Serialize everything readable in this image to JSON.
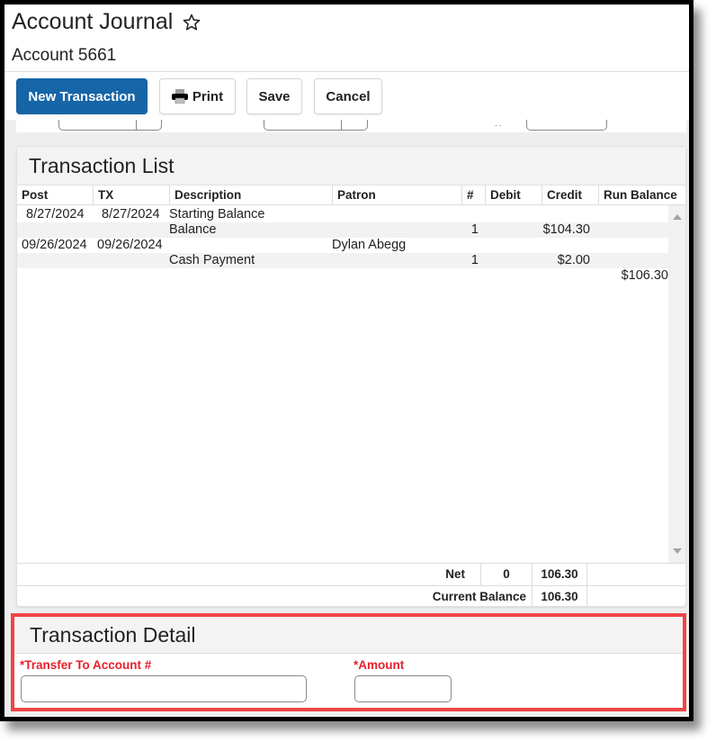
{
  "header": {
    "title": "Account Journal",
    "favorite_icon": "star-outline-icon",
    "subtitle": "Account 5661"
  },
  "toolbar": {
    "new_transaction_label": "New Transaction",
    "print_label": "Print",
    "print_icon": "printer-icon",
    "save_label": "Save",
    "cancel_label": "Cancel"
  },
  "transaction_list": {
    "title": "Transaction List",
    "columns": [
      "Post",
      "TX",
      "Description",
      "Patron",
      "#",
      "Debit",
      "Credit",
      "Run Balance"
    ],
    "rows": [
      {
        "post": "8/27/2024",
        "tx": "8/27/2024",
        "description": "Starting Balance",
        "patron": "",
        "count": "",
        "debit": "",
        "credit": "",
        "run_balance": ""
      },
      {
        "post": "",
        "tx": "",
        "description": "Balance",
        "patron": "",
        "count": "1",
        "debit": "",
        "credit": "$104.30",
        "run_balance": ""
      },
      {
        "post": "09/26/2024",
        "tx": "09/26/2024",
        "description": "",
        "patron": "Dylan Abegg",
        "count": "",
        "debit": "",
        "credit": "",
        "run_balance": ""
      },
      {
        "post": "",
        "tx": "",
        "description": "Cash Payment",
        "patron": "",
        "count": "1",
        "debit": "",
        "credit": "$2.00",
        "run_balance": ""
      },
      {
        "post": "",
        "tx": "",
        "description": "",
        "patron": "",
        "count": "",
        "debit": "",
        "credit": "",
        "run_balance": "$106.30"
      }
    ],
    "totals": {
      "net_label": "Net",
      "net_debit": "0",
      "net_credit": "106.30",
      "current_balance_label": "Current Balance",
      "current_balance_value": "106.30"
    }
  },
  "transaction_detail": {
    "title": "Transaction Detail",
    "transfer_label": "*Transfer To Account #",
    "transfer_value": "",
    "amount_label": "*Amount",
    "amount_value": ""
  },
  "colors": {
    "primary": "#1565a7",
    "required": "#e8202a",
    "highlight": "#f04444"
  }
}
